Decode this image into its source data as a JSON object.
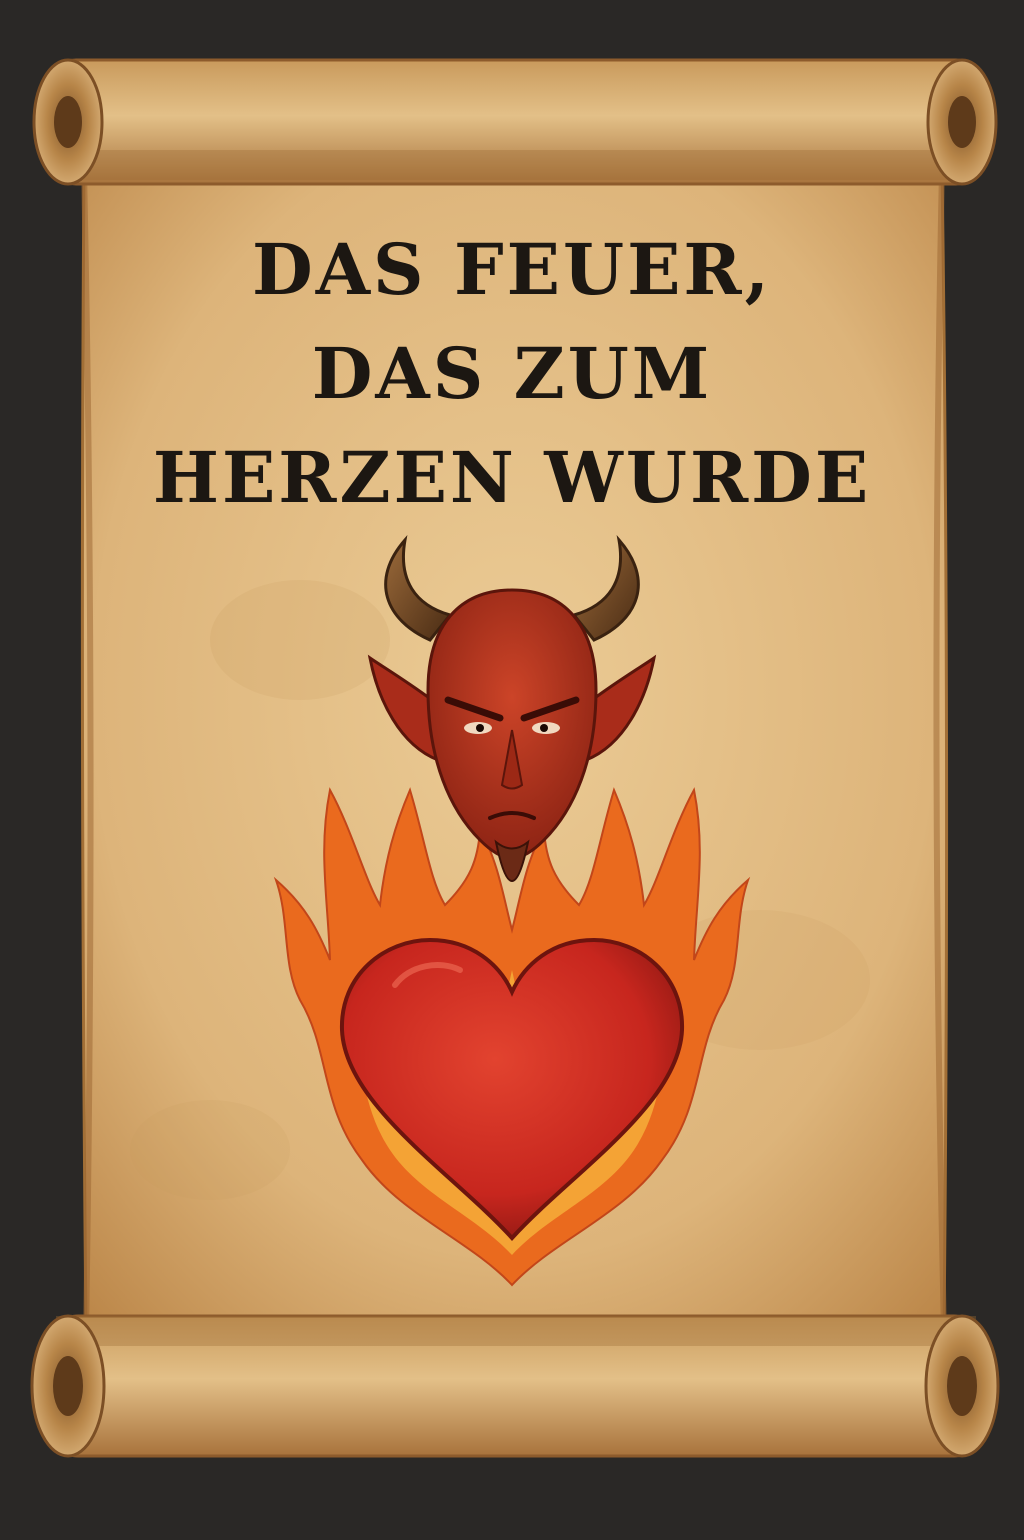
{
  "poster": {
    "title_lines": [
      "DAS FEUER,",
      "DAS ZUM",
      "HERZEN WURDE"
    ]
  },
  "icons": {
    "character": "devil-head-icon",
    "symbol": "flaming-heart-icon"
  },
  "colors": {
    "background": "#2a2826",
    "parchment": "#e2bd85",
    "parchment_edge": "#b98345",
    "ink": "#1c1712",
    "devil_skin": "#b8331f",
    "horn": "#7a4a25",
    "flame_outer": "#ee6a1c",
    "flame_inner": "#f7b23c",
    "heart": "#cc2a22"
  }
}
